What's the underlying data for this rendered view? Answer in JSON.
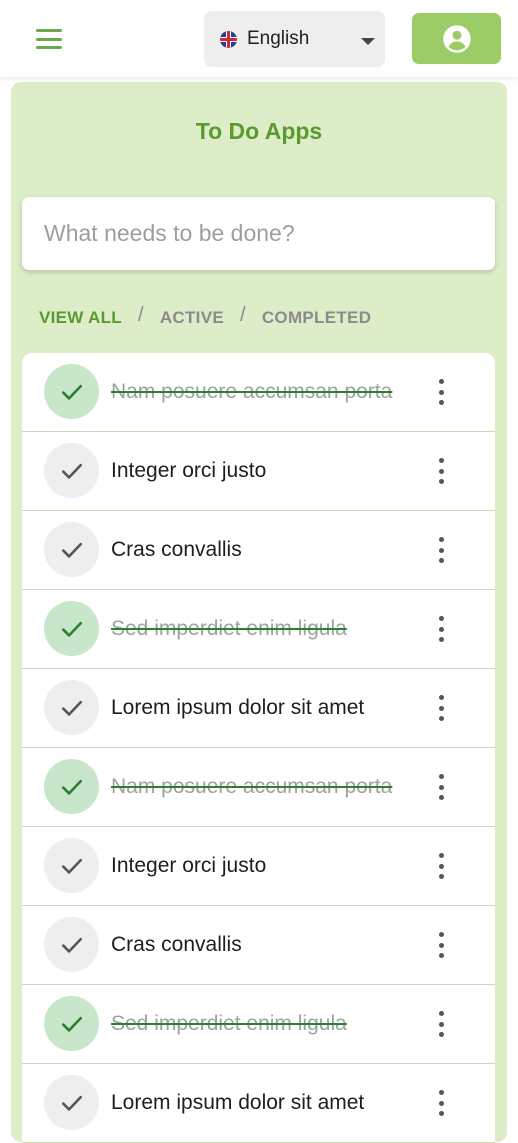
{
  "header": {
    "language": "English",
    "flag_icon": "uk-flag-icon",
    "menu_icon": "hamburger-menu-icon",
    "account_icon": "account-circle-icon"
  },
  "app": {
    "title": "To Do Apps",
    "input_placeholder": "What needs to be done?"
  },
  "filters": {
    "view_all": "VIEW ALL",
    "separator": "/",
    "active": "ACTIVE",
    "completed": "COMPLETED",
    "selected": "VIEW ALL"
  },
  "todos": [
    {
      "text": "Nam posuere accumsan porta",
      "completed": true
    },
    {
      "text": "Integer orci justo",
      "completed": false
    },
    {
      "text": "Cras convallis",
      "completed": false
    },
    {
      "text": "Sed imperdiet enim ligula",
      "completed": true
    },
    {
      "text": "Lorem ipsum dolor sit amet",
      "completed": false
    },
    {
      "text": "Nam posuere accumsan porta",
      "completed": true
    },
    {
      "text": "Integer orci justo",
      "completed": false
    },
    {
      "text": "Cras convallis",
      "completed": false
    },
    {
      "text": "Sed imperdiet enim ligula",
      "completed": true
    },
    {
      "text": "Lorem ipsum dolor sit amet",
      "completed": false
    }
  ],
  "colors": {
    "accent": "#5a9a2e",
    "card_background": "#dcedc8",
    "account_button": "#9ccc65",
    "check_done": "#c8e6c9"
  }
}
